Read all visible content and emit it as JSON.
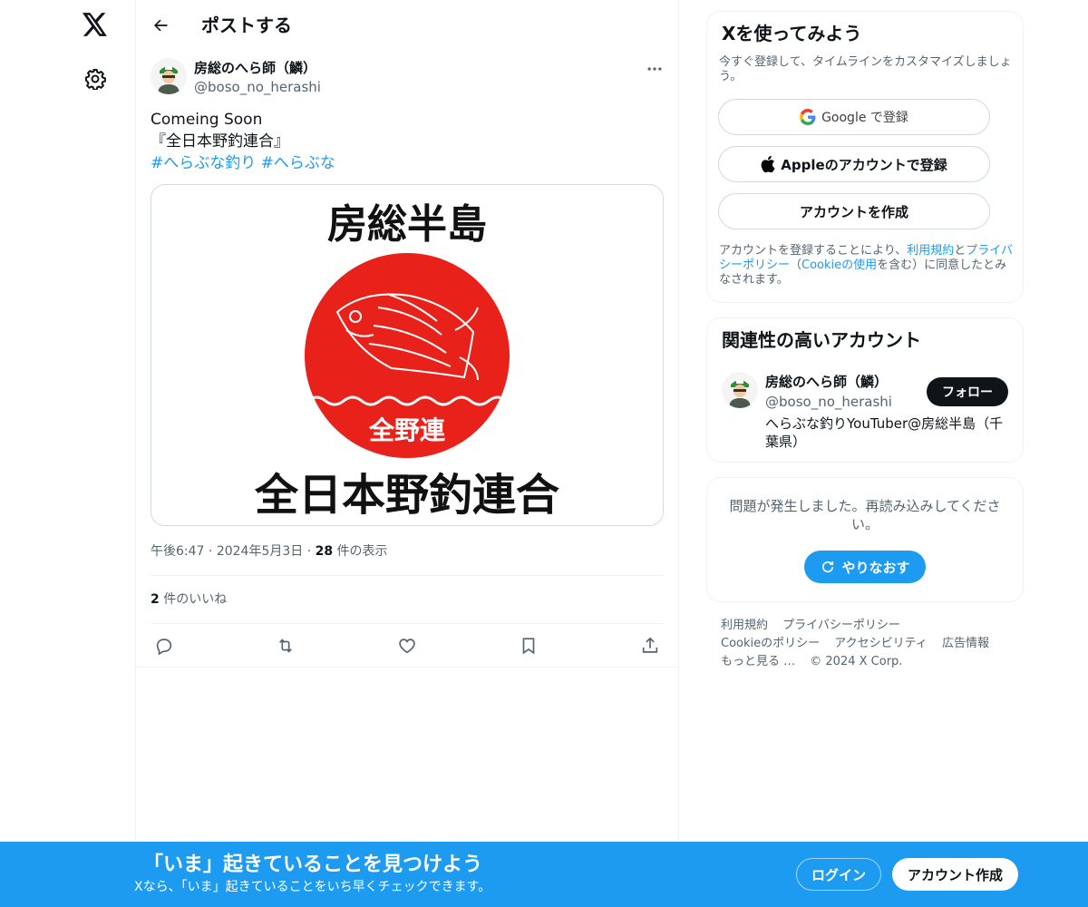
{
  "colors": {
    "accent": "#1d9bf0",
    "text": "#0f1419",
    "muted": "#536471",
    "media_red": "#e8221a"
  },
  "header": {
    "title": "ポストする"
  },
  "post": {
    "author_name": "房総のへら師（鱗）",
    "author_handle": "@boso_no_herashi",
    "text_line1": "Comeing Soon",
    "text_line2": "『全日本野釣連合』",
    "hashtag1": "#へらぶな釣り",
    "hashtag2": "#へらぶな",
    "media": {
      "top_text": "房総半島",
      "badge_text": "全野連",
      "bottom_text": "全日本野釣連合"
    },
    "time": "午後6:47",
    "date": "2024年5月3日",
    "views_count": "28",
    "views_label": " 件の表示",
    "likes_count": "2",
    "likes_label": " 件のいいね"
  },
  "signup_card": {
    "title": "Xを使ってみよう",
    "subtitle": "今すぐ登録して、タイムラインをカスタマイズしましょう。",
    "google_label": "Google で登録",
    "apple_label": "Appleのアカウントで登録",
    "create_label": "アカウントを作成",
    "terms_prefix": "アカウントを登録することにより、",
    "terms_link1": "利用規約",
    "terms_and": "と",
    "terms_link2": "プライバシーポリシー",
    "terms_mid": "（",
    "terms_link3": "Cookieの使用",
    "terms_suffix": "を含む）に同意したとみなされます。"
  },
  "related_card": {
    "title": "関連性の高いアカウント",
    "name": "房総のへら師（鱗）",
    "handle": "@boso_no_herashi",
    "follow_label": "フォロー",
    "bio": "へらぶな釣りYouTuber@房総半島（千葉県）"
  },
  "error_card": {
    "message": "問題が発生しました。再読み込みしてください。",
    "retry_label": "やりなおす"
  },
  "footer": {
    "links": [
      "利用規約",
      "プライバシーポリシー",
      "Cookieのポリシー",
      "アクセシビリティ",
      "広告情報",
      "もっと見る …",
      "© 2024 X Corp."
    ]
  },
  "banner": {
    "title": "「いま」起きていることを見つけよう",
    "subtitle": "Xなら、「いま」起きていることをいち早くチェックできます。",
    "login_label": "ログイン",
    "signup_label": "アカウント作成"
  },
  "icons": [
    "x-logo-icon",
    "gear-icon",
    "back-arrow-icon",
    "more-icon",
    "reply-icon",
    "repost-icon",
    "like-icon",
    "bookmark-icon",
    "share-icon",
    "google-icon",
    "apple-icon",
    "refresh-icon"
  ]
}
